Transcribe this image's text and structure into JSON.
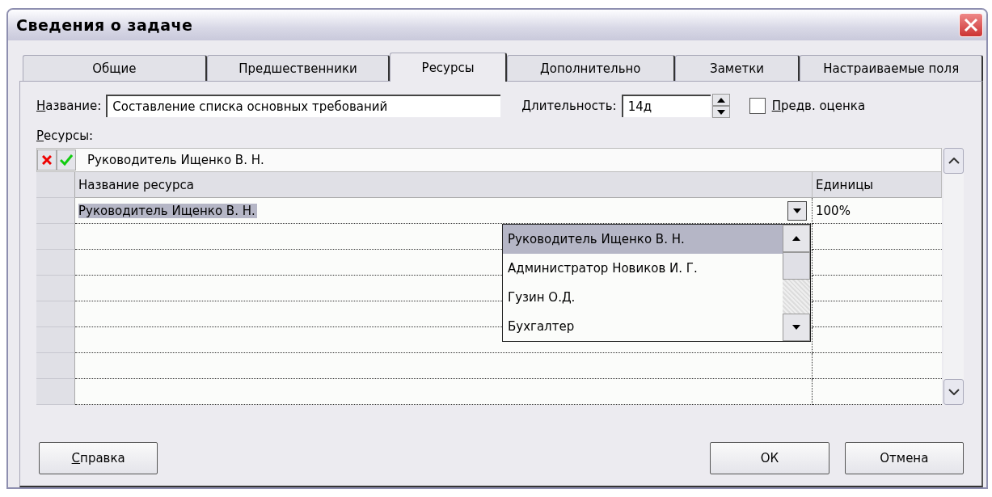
{
  "window": {
    "title": "Сведения о задаче"
  },
  "tabs": [
    {
      "label": "Общие",
      "selected": false
    },
    {
      "label": "Предшественники",
      "selected": false
    },
    {
      "label": "Ресурсы",
      "selected": true
    },
    {
      "label": "Дополнительно",
      "selected": false
    },
    {
      "label": "Заметки",
      "selected": false
    },
    {
      "label": "Настраиваемые поля",
      "selected": false
    }
  ],
  "name_field": {
    "label": "Название:",
    "value": "Составление списка основных требований"
  },
  "duration_field": {
    "label": "Длительность:",
    "value": "14д"
  },
  "estimate_checkbox": {
    "label": "Предв. оценка",
    "checked": false
  },
  "resources_label": "Ресурсы:",
  "entry_bar": {
    "value": "Руководитель Ищенко В. Н."
  },
  "table": {
    "columns": [
      "Название ресурса",
      "Единицы"
    ],
    "rows": [
      {
        "name": "Руководитель Ищенко В. Н.",
        "units": "100%",
        "selected": true
      }
    ]
  },
  "dropdown": {
    "items": [
      {
        "label": "Руководитель Ищенко В. Н.",
        "selected": true
      },
      {
        "label": "Администратор Новиков И. Г.",
        "selected": false
      },
      {
        "label": "Гузин О.Д.",
        "selected": false
      },
      {
        "label": "Бухгалтер",
        "selected": false
      }
    ]
  },
  "buttons": [
    "Справка",
    "ОК",
    "Отмена"
  ]
}
